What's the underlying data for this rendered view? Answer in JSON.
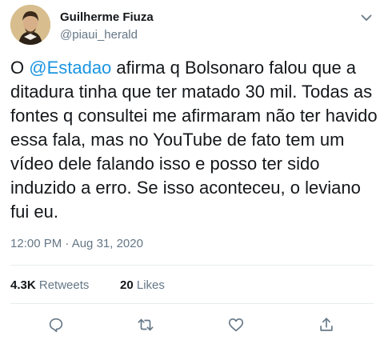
{
  "author": {
    "name": "Guilherme Fiuza",
    "handle": "@piaui_herald"
  },
  "tweet": {
    "prefix": "O ",
    "mention": "@Estadao",
    "text": " afirma q Bolsonaro falou que a ditadura tinha que ter matado 30 mil. Todas as fontes q consultei me afirmaram não ter havido essa fala, mas no YouTube de fato tem um vídeo dele falando isso e posso ter sido induzido a erro. Se isso aconteceu, o leviano fui eu.",
    "timestamp": "12:00 PM · Aug 31, 2020"
  },
  "stats": {
    "retweets_count": "4.3K",
    "retweets_label": "Retweets",
    "likes_count": "20",
    "likes_label": "Likes"
  },
  "icons": {
    "caret": "chevron-down-icon",
    "reply": "reply-icon",
    "retweet": "retweet-icon",
    "like": "heart-icon",
    "share": "share-icon"
  },
  "colors": {
    "link": "#1b95e0",
    "secondary_text": "#657786",
    "primary_text": "#14171a",
    "icon": "#657786"
  }
}
